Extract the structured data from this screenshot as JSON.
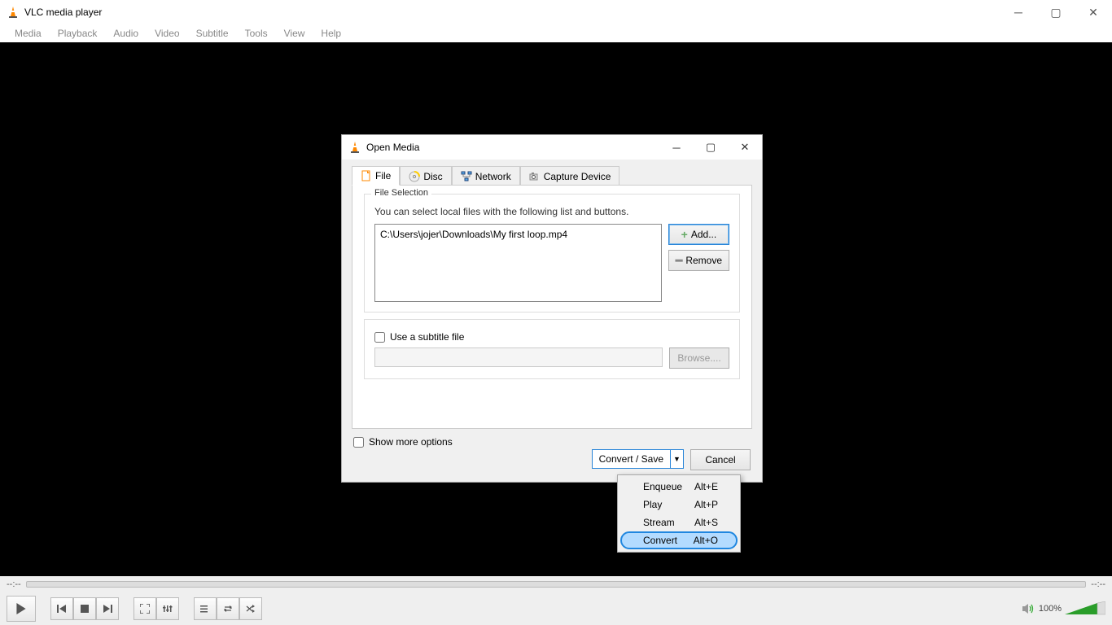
{
  "window": {
    "title": "VLC media player"
  },
  "menus": [
    "Media",
    "Playback",
    "Audio",
    "Video",
    "Subtitle",
    "Tools",
    "View",
    "Help"
  ],
  "player": {
    "time_start": "--:--",
    "time_end": "--:--",
    "volume_text": "100%"
  },
  "dialog": {
    "title": "Open Media",
    "tabs": {
      "file": "File",
      "disc": "Disc",
      "network": "Network",
      "capture": "Capture Device"
    },
    "fileselection": {
      "legend": "File Selection",
      "desc": "You can select local files with the following list and buttons.",
      "files": [
        "C:\\Users\\jojer\\Downloads\\My first loop.mp4"
      ],
      "add": "Add...",
      "remove": "Remove"
    },
    "subtitle_check": "Use a subtitle file",
    "browse": "Browse....",
    "show_more": "Show more options",
    "convert_save": "Convert / Save",
    "cancel": "Cancel"
  },
  "dropdown": {
    "items": [
      {
        "label": "Enqueue",
        "shortcut": "Alt+E"
      },
      {
        "label": "Play",
        "shortcut": "Alt+P"
      },
      {
        "label": "Stream",
        "shortcut": "Alt+S"
      },
      {
        "label": "Convert",
        "shortcut": "Alt+O"
      }
    ]
  }
}
